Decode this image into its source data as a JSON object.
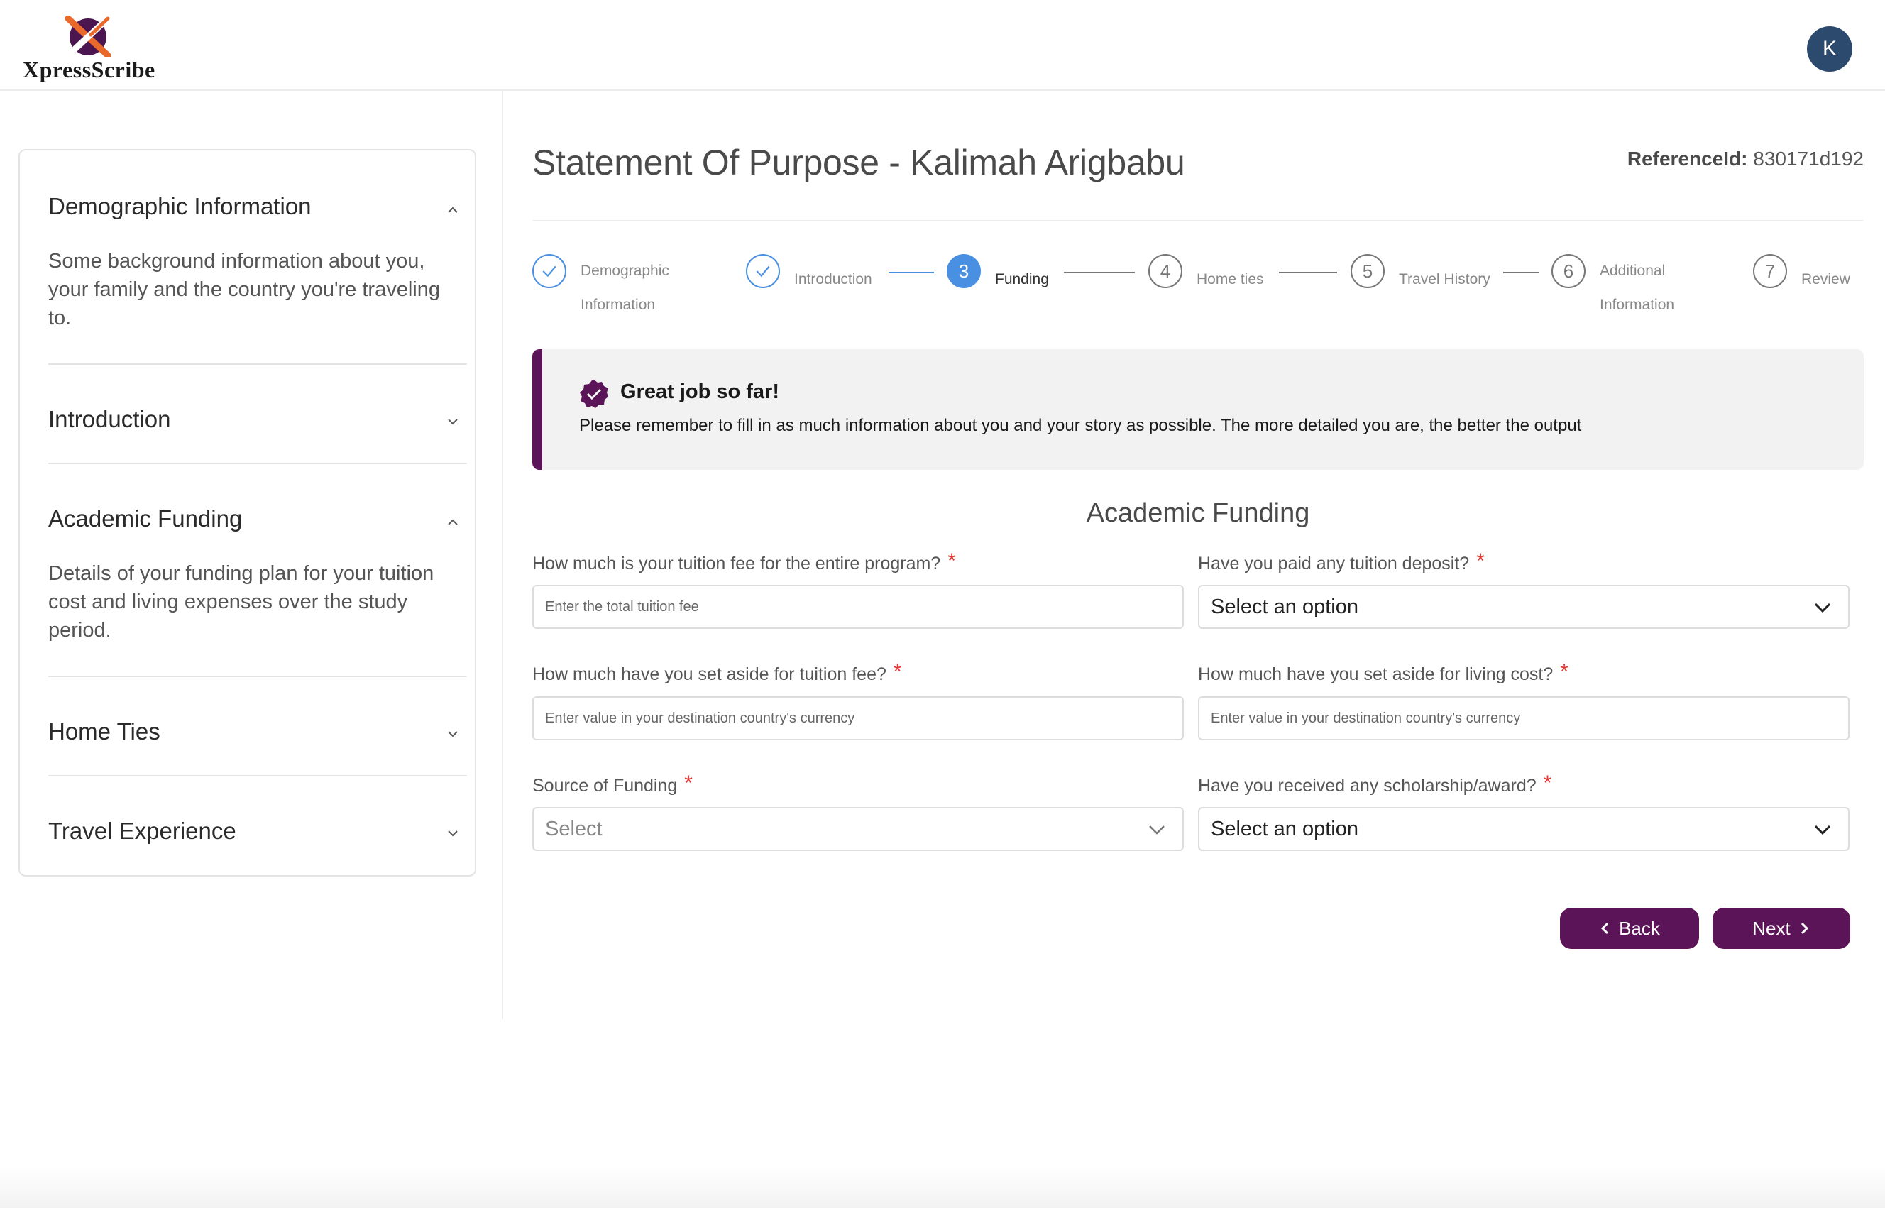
{
  "brand": {
    "name": "XpressScribe",
    "avatar_initial": "K"
  },
  "sidebar": {
    "items": [
      {
        "title": "Demographic Information",
        "expanded": true,
        "description": "Some background information about you, your family and the country you're traveling to."
      },
      {
        "title": "Introduction",
        "expanded": false,
        "description": ""
      },
      {
        "title": "Academic Funding",
        "expanded": true,
        "description": "Details of your funding plan for your tuition cost and living expenses over the study period."
      },
      {
        "title": "Home Ties",
        "expanded": false,
        "description": ""
      },
      {
        "title": "Travel Experience",
        "expanded": false,
        "description": ""
      }
    ]
  },
  "page": {
    "title": "Statement Of Purpose - Kalimah Arigbabu",
    "reference_label": "ReferenceId:",
    "reference_value": "830171d192"
  },
  "stepper": {
    "steps": [
      {
        "number": "1",
        "label": "Demographic Information",
        "state": "done"
      },
      {
        "number": "2",
        "label": "Introduction",
        "state": "done"
      },
      {
        "number": "3",
        "label": "Funding",
        "state": "active"
      },
      {
        "number": "4",
        "label": "Home ties",
        "state": "pending"
      },
      {
        "number": "5",
        "label": "Travel History",
        "state": "pending"
      },
      {
        "number": "6",
        "label": "Additional Information",
        "state": "pending"
      },
      {
        "number": "7",
        "label": "Review",
        "state": "pending"
      }
    ]
  },
  "alert": {
    "title": "Great job so far!",
    "message": "Please remember to fill in as much information about you and your story as possible. The more detailed you are, the better the output"
  },
  "form": {
    "section_title": "Academic Funding",
    "required_mark": "*",
    "tuition_fee": {
      "label": "How much is your tuition fee for the entire program?",
      "placeholder": "Enter the total tuition fee"
    },
    "tuition_deposit": {
      "label": "Have you paid any tuition deposit?",
      "value": "Select an option"
    },
    "tuition_aside": {
      "label": "How much have you set aside for tuition fee?",
      "placeholder": "Enter value in your destination country's currency"
    },
    "living_aside": {
      "label": "How much have you set aside for living cost?",
      "placeholder": "Enter value in your destination country's currency"
    },
    "funding_source": {
      "label": "Source of Funding",
      "value": "Select"
    },
    "scholarship": {
      "label": "Have you received any scholarship/award?",
      "value": "Select an option"
    }
  },
  "actions": {
    "back_label": "Back",
    "next_label": "Next"
  },
  "colors": {
    "brand": "#5b1457",
    "step_blue": "#4a90e2",
    "required": "#e53935"
  }
}
